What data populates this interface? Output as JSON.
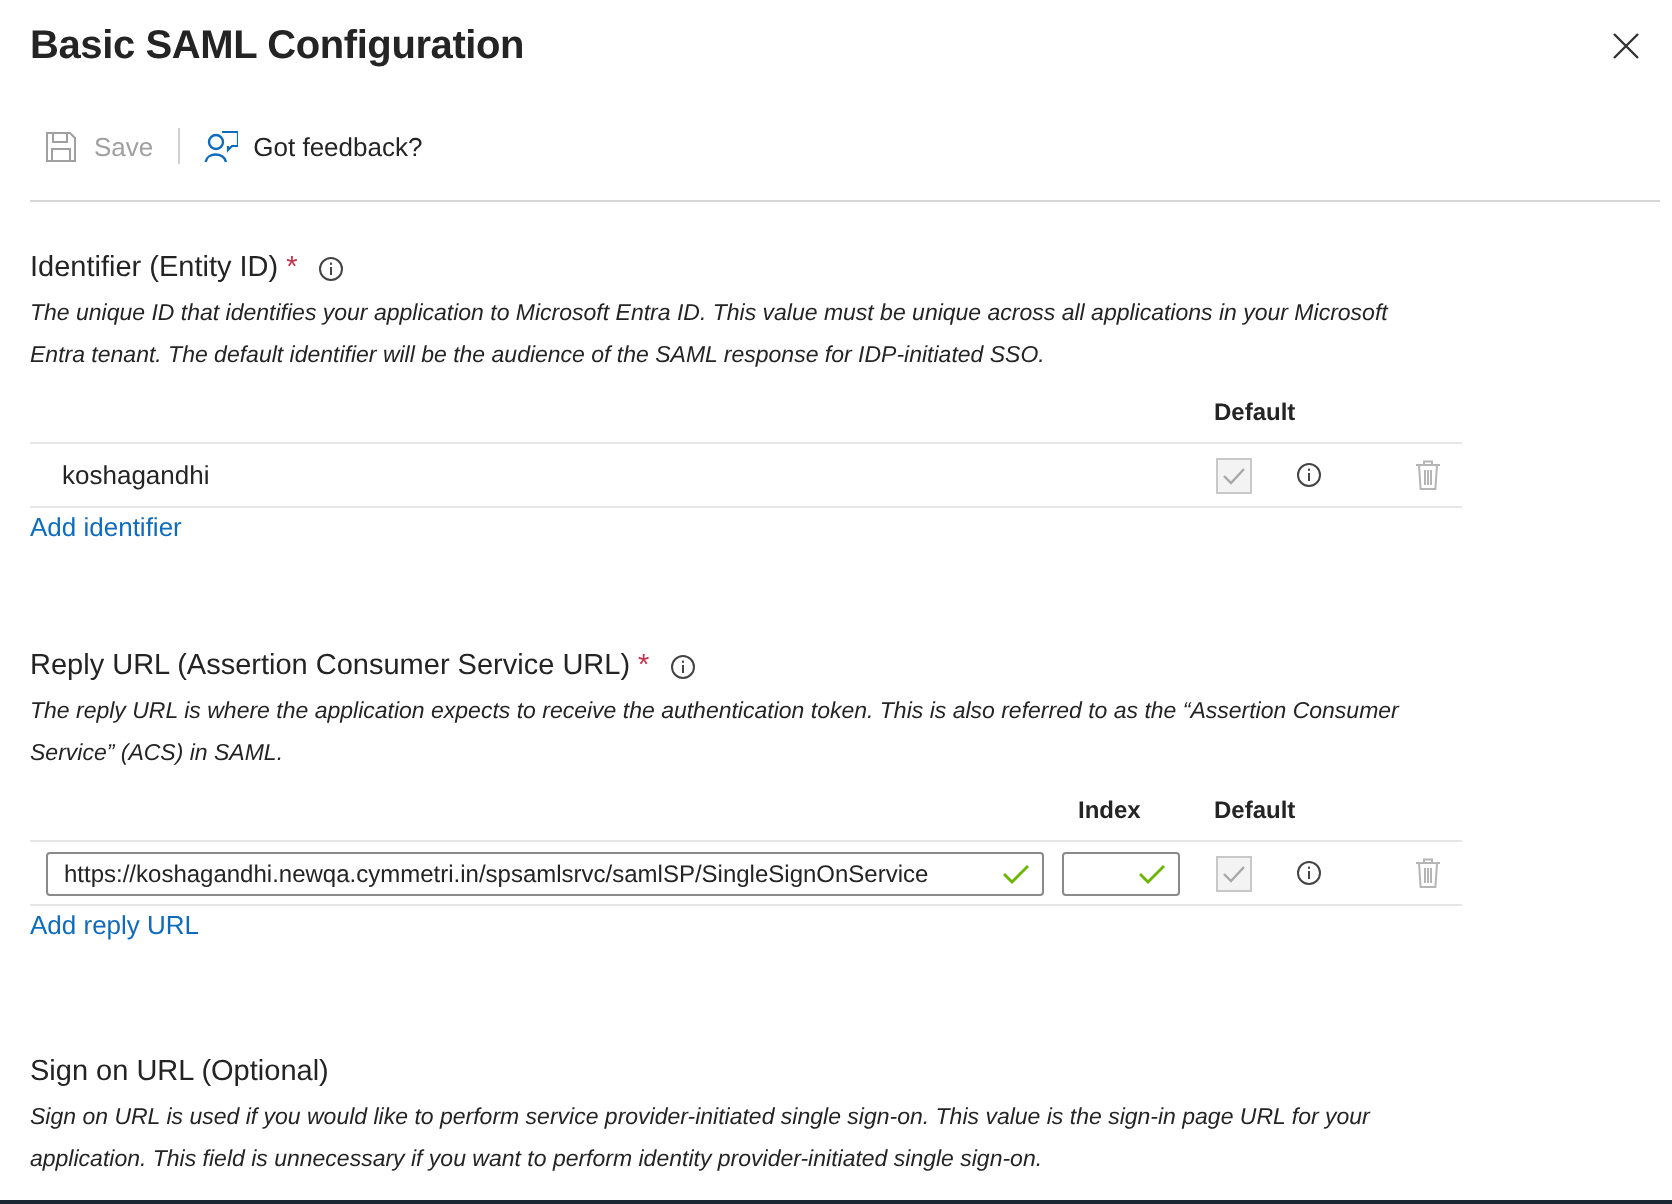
{
  "panel": {
    "title": "Basic SAML Configuration"
  },
  "toolbar": [
    {
      "kind": "save",
      "label": "Save",
      "disabled": true
    },
    {
      "kind": "feedback",
      "label": "Got feedback?",
      "disabled": false
    }
  ],
  "sections": [
    {
      "heading": "Identifier (Entity ID)",
      "required_mark": "*",
      "info": true,
      "description": "The unique ID that identifies your application to Microsoft Entra ID. This value must be unique across all applications in your Microsoft Entra tenant. The default identifier will be the audience of the SAML response for IDP-initiated SSO.",
      "table": {
        "columns": [
          {
            "kind": "default",
            "label": "Default"
          }
        ],
        "rows": [
          {
            "kind": "text",
            "value": "koshagandhi",
            "default": true
          }
        ]
      },
      "add_link": "Add identifier"
    },
    {
      "heading": "Reply URL (Assertion Consumer Service URL)",
      "required_mark": "*",
      "info": true,
      "description": "The reply URL is where the application expects to receive the authentication token. This is also referred to as the “Assertion Consumer Service” (ACS) in SAML.",
      "table": {
        "columns": [
          {
            "kind": "index",
            "label": "Index"
          },
          {
            "kind": "default",
            "label": "Default"
          }
        ],
        "rows": [
          {
            "kind": "input",
            "value": "https://koshagandhi.newqa.cymmetri.in/spsamlsrvc/samlSP/SingleSignOnService",
            "valid": true,
            "index_valid": true,
            "default": true
          }
        ]
      },
      "add_link": "Add reply URL"
    },
    {
      "heading": "Sign on URL (Optional)",
      "description": "Sign on URL is used if you would like to perform service provider-initiated single sign-on. This value is the sign-in page URL for your application. This field is unnecessary if you want to perform identity provider-initiated single sign-on."
    }
  ]
}
